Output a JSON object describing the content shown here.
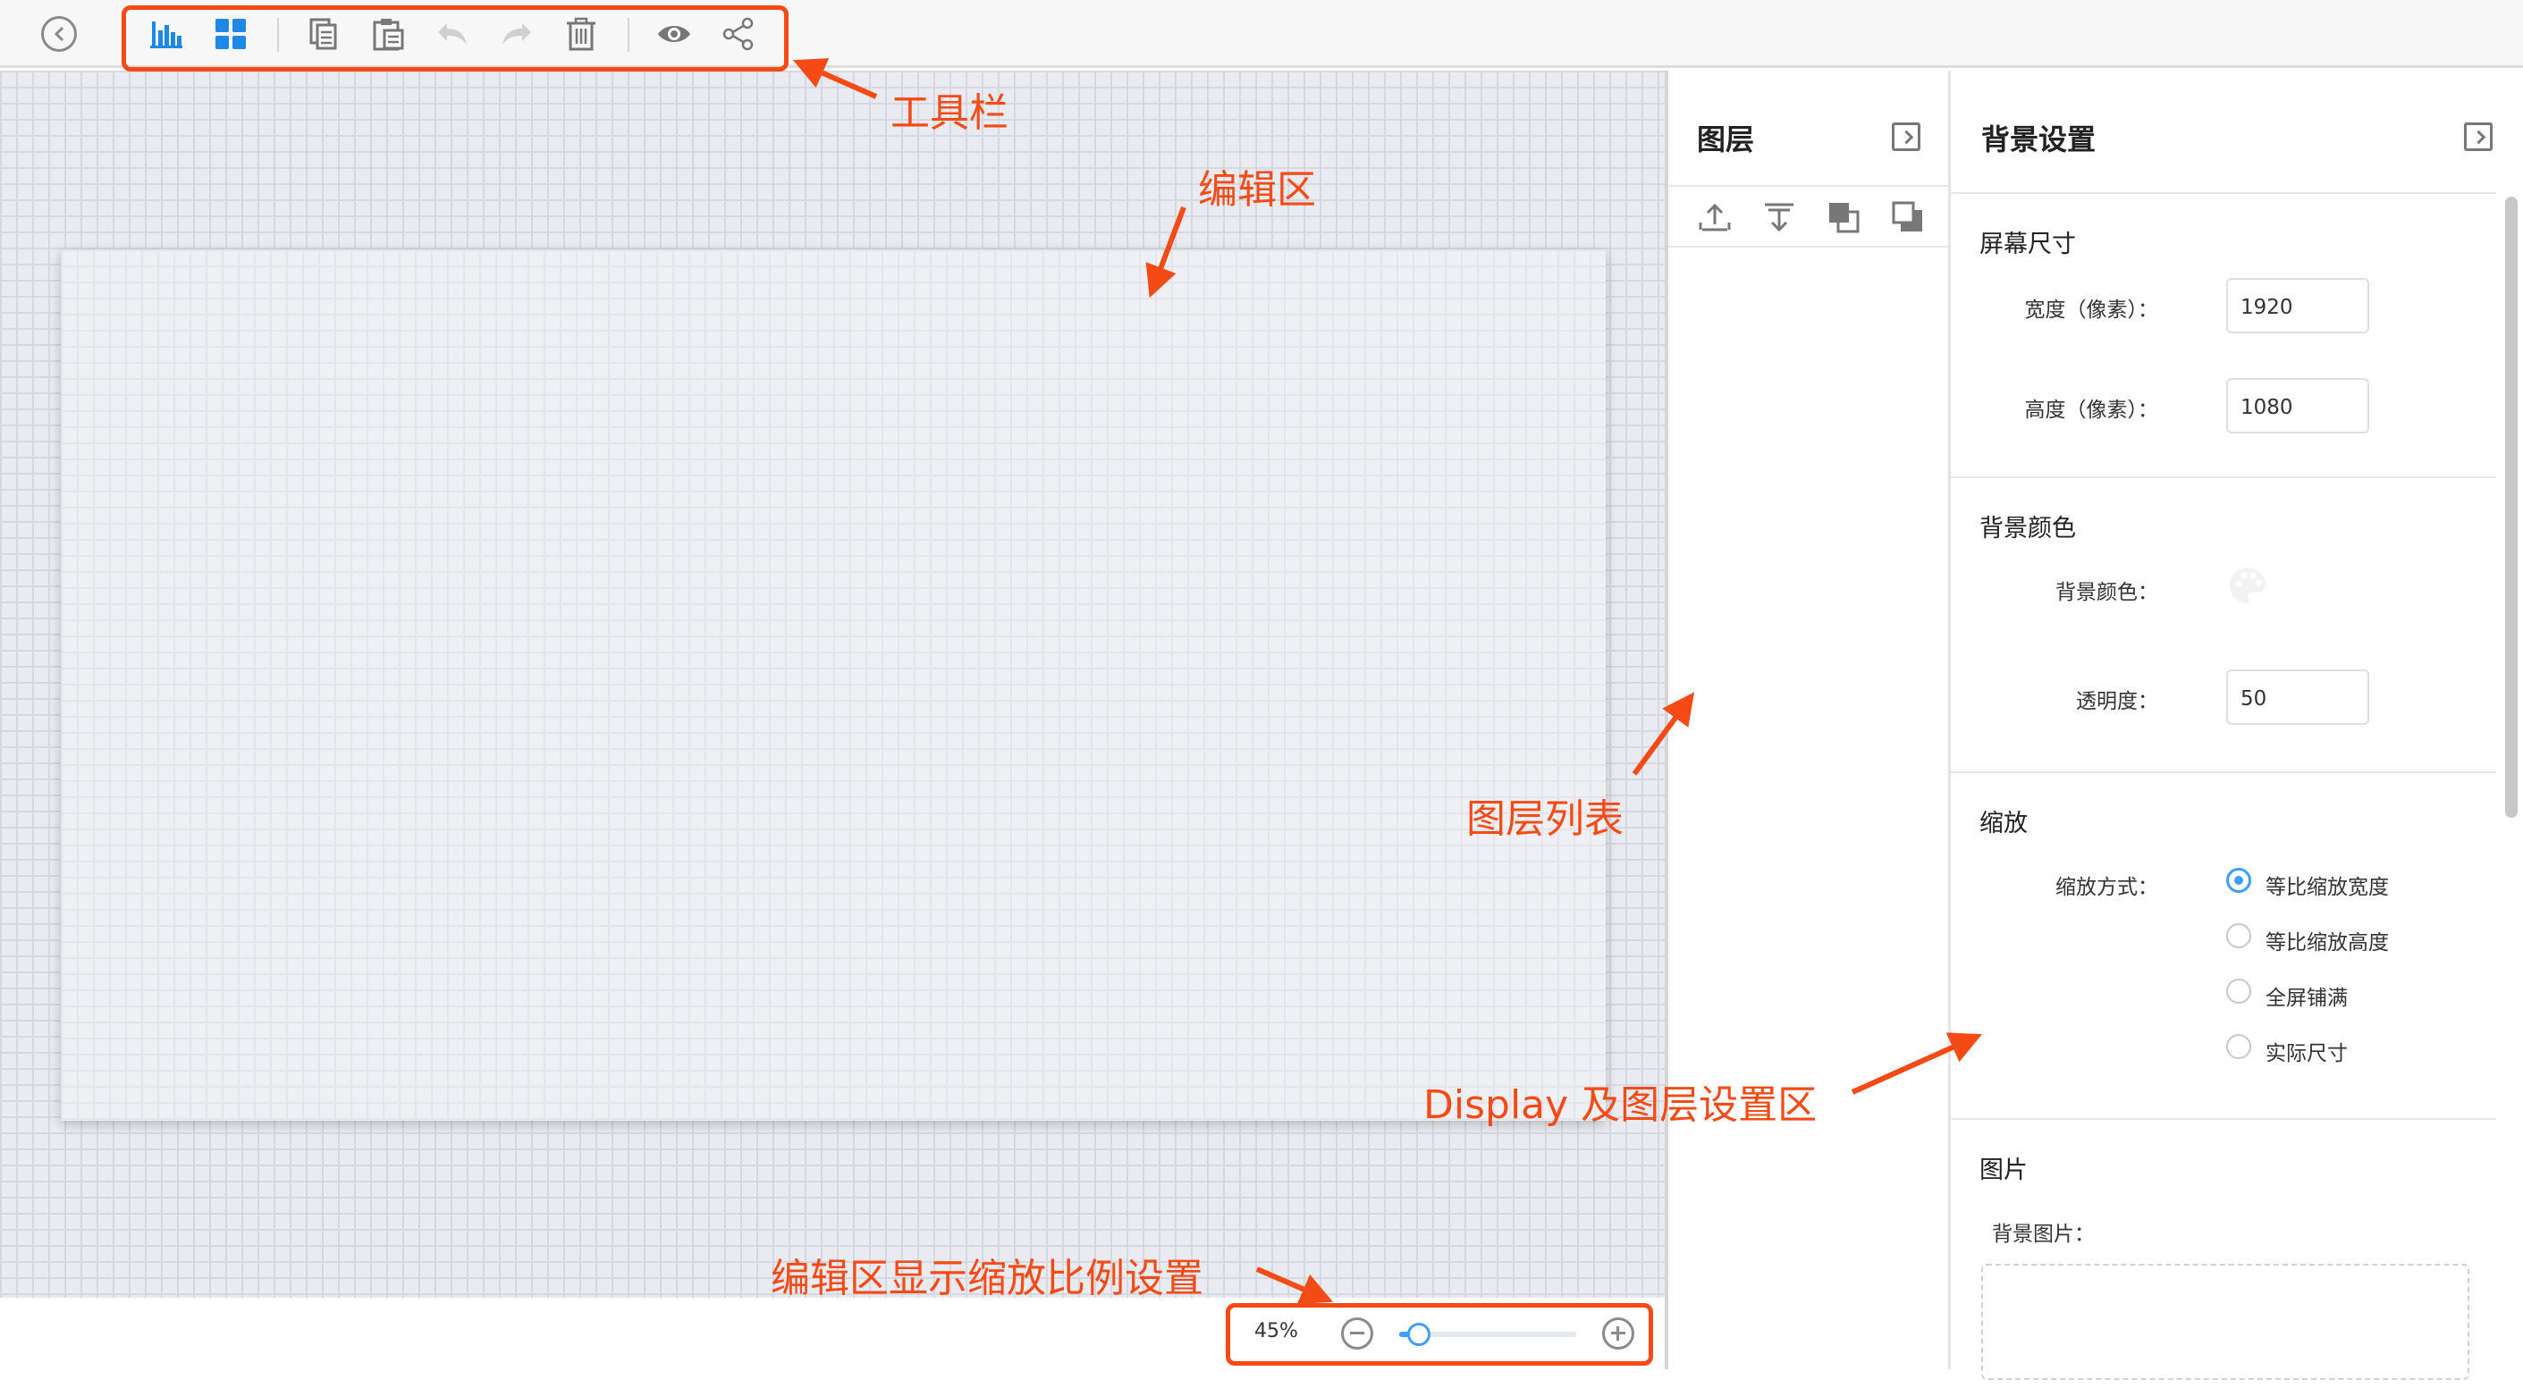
{
  "toolbar": {
    "icons": [
      "back-icon",
      "chart-icon",
      "grid-icon",
      "copy-icon",
      "paste-icon",
      "undo-icon",
      "redo-icon",
      "trash-icon",
      "eye-icon",
      "share-icon"
    ]
  },
  "zoom": {
    "value_text": "45%",
    "slider_fraction": 0.11
  },
  "layers_panel": {
    "title": "图层",
    "tools": [
      "move-up-icon",
      "move-down-icon",
      "bring-to-front-icon",
      "send-to-back-icon"
    ]
  },
  "settings": {
    "title": "背景设置",
    "screen_size": {
      "title": "屏幕尺寸",
      "width_label": "宽度（像素）：",
      "width_value": "1920",
      "height_label": "高度（像素）：",
      "height_value": "1080"
    },
    "bg_color": {
      "title": "背景颜色",
      "color_label": "背景颜色：",
      "opacity_label": "透明度：",
      "opacity_value": "50"
    },
    "scale": {
      "title": "缩放",
      "mode_label": "缩放方式：",
      "options": [
        "等比缩放宽度",
        "等比缩放高度",
        "全屏铺满",
        "实际尺寸"
      ],
      "selected": "等比缩放宽度"
    },
    "image": {
      "title": "图片",
      "bg_image_label": "背景图片："
    }
  },
  "annotations": {
    "toolbar": "工具栏",
    "editor": "编辑区",
    "layer_list": "图层列表",
    "display_area": "Display 及图层设置区",
    "zoom_setting": "编辑区显示缩放比例设置"
  },
  "colors": {
    "accent": "#409eff",
    "annotation": "#f44a16",
    "icon_blue": "#1e88e5",
    "icon_gray": "#777777",
    "icon_disabled": "#d0d0d0"
  }
}
